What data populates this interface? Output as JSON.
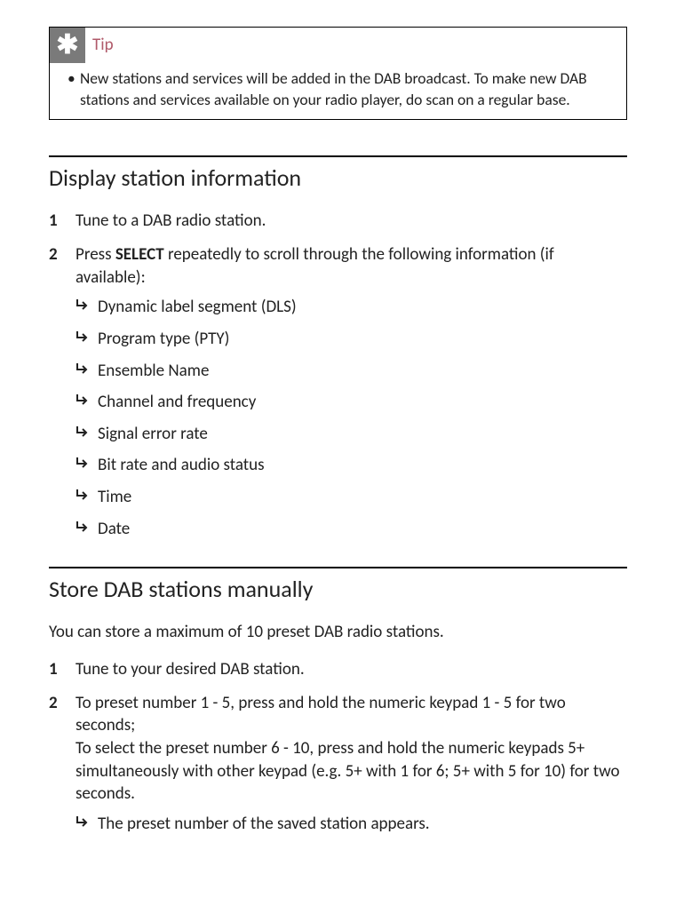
{
  "tip": {
    "label": "Tip",
    "body": "New stations and services will be added in the DAB broadcast. To make new DAB stations and services available on your radio player, do scan on a regular base."
  },
  "section1": {
    "heading": "Display station information",
    "step1": "Tune to a DAB radio station.",
    "step2_pre": "Press ",
    "step2_bold": "SELECT",
    "step2_post": " repeatedly to scroll through the following information (if available):",
    "sub": [
      "Dynamic label segment (DLS)",
      "Program type (PTY)",
      "Ensemble Name",
      "Channel and frequency",
      "Signal error rate",
      "Bit rate and audio status",
      "Time",
      "Date"
    ]
  },
  "section2": {
    "heading": "Store DAB stations manually",
    "intro": "You can store a maximum of 10 preset DAB radio stations.",
    "step1": "Tune to your desired DAB station.",
    "step2": "To preset number 1 - 5, press and hold the numeric keypad 1 - 5 for two seconds;\nTo select the preset number 6 - 10, press and hold the numeric keypads 5+ simultaneously with other keypad (e.g. 5+ with 1 for 6; 5+ with 5 for 10) for two seconds.",
    "step2_sub": "The preset number of the saved station appears."
  }
}
